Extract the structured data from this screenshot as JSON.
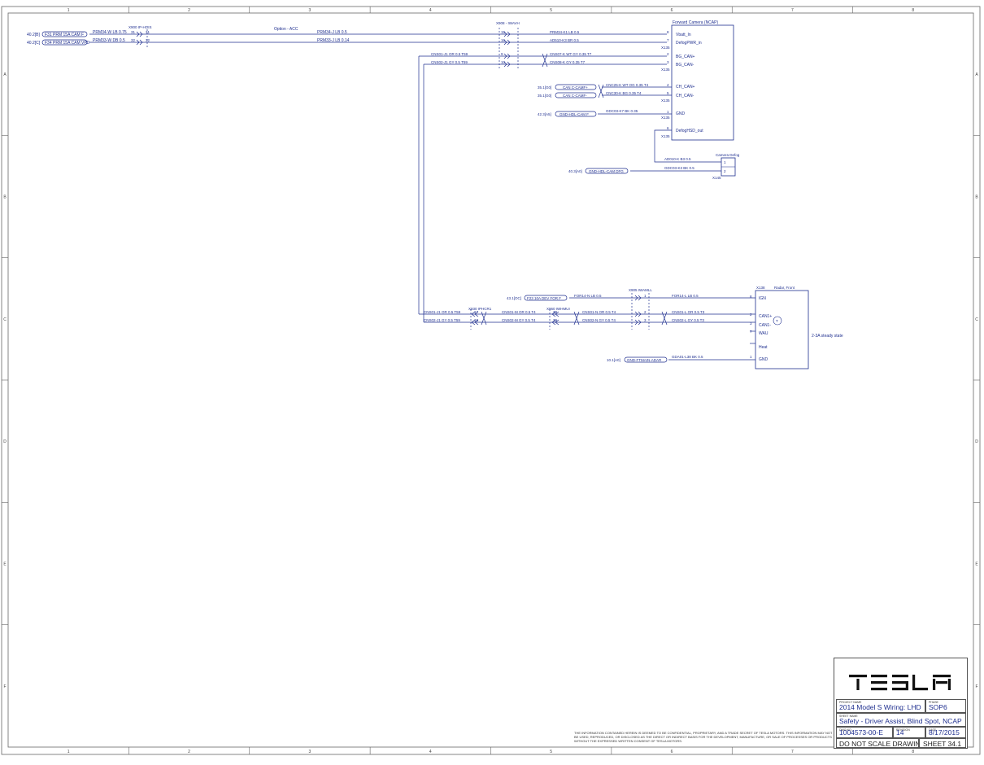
{
  "grid": {
    "columns": [
      "1",
      "2",
      "3",
      "4",
      "5",
      "6",
      "7",
      "8"
    ],
    "rows": [
      "A",
      "B",
      "C",
      "D",
      "E",
      "F"
    ]
  },
  "colors": {
    "wire": "#1f2f8f",
    "frame": "#666666",
    "text": "#1f2f8f"
  },
  "diagram": {
    "option_label": "Option - ACC",
    "top_left": {
      "connector": "X900 IP-HOIS",
      "wire1": {
        "ref": "40.2[B]",
        "fuse": "F31 PRM 15A CAM F",
        "w1": "PRM34-W LB 0.75",
        "pin_l": "31",
        "pin_r": "31",
        "w2": "PRM34-J LB 0.5"
      },
      "wire2": {
        "ref": "40.2[C]",
        "fuse": "F34 PRM 15A CAM VPD",
        "w1": "PRM33-W DB 0.5",
        "pin_l": "32",
        "pin_r": "32",
        "w2": "PRM33-J LB 0.14"
      }
    },
    "x908": {
      "label": "X908 - IWAVH",
      "pins": [
        "15",
        "16",
        "9",
        "10"
      ],
      "wires": [
        "PRM34-K1 LB 0.5",
        "AD510-K3 BR 0.5",
        "CNS07-K WT GY 0.35 T7",
        "CNS08-K GY 0.35 T7"
      ],
      "left_wires": [
        "CNS01-J1 OR 0.5 T59",
        "CNS02-J1 GY 0.5 T59"
      ]
    },
    "camera": {
      "title": "Forward Camera (NCAP)",
      "pins": [
        "8",
        "7",
        "2",
        "3",
        "4",
        "5",
        "1",
        "6"
      ],
      "labels": [
        "Vbatt_In",
        "DefogPWR_in",
        "BG_CAN+",
        "BG_CAN-",
        "CH_CAN+",
        "CH_CAN-",
        "GND",
        "DefogHSD_out"
      ],
      "conn": [
        "X135",
        "X135",
        "X135",
        "X135",
        "X135"
      ],
      "ch_wires": [
        "CNC25-K WT OG 0.35 T4",
        "CNC30-K BG 0.35 T4"
      ],
      "ch_refs": [
        "35.1[G0]",
        "35.1[G0]"
      ],
      "ch_splices": [
        "CAN C-CAMF+",
        "CAN C-CAMF-"
      ],
      "gnd_ref": "42.3[A5]",
      "gnd_splice": "GND-HDL-CAM F",
      "gnd_wire": "GDC03-K7 BK 0.35"
    },
    "defog": {
      "title": "Camera Defog",
      "conn": "X145",
      "pins": [
        "1",
        "2"
      ],
      "w1": "AD010-K B3 0.5",
      "w2": "GDC03-K3 BK 0.5",
      "ref": "40.3[A0]",
      "splice": "GND-HDL-CAM DFG"
    },
    "radar": {
      "title": "Radar, Front",
      "conn": "X138",
      "pins": [
        "8",
        "2",
        "3",
        "7",
        "1"
      ],
      "labels": [
        "IGN",
        "CAN1+",
        "CAN1-",
        "WAU",
        "Heat",
        "GND"
      ],
      "note": "2-3A steady state",
      "twist_label": "T",
      "ign_ref": "43.1[OC]",
      "ign_fuse": "F23 10A DEV FOR F",
      "ign_w1": "FOR14-N LB 0.5",
      "ign_w2": "FOR14-L LB 0.5",
      "x905": "X905 IWAMLL",
      "x930": "X930 IPHCR1",
      "x960": "X960 IWHMUI",
      "can_wires_left": [
        "CNS01-J1 OR 0.5 T59",
        "CNS02-J1 GY 0.5 T59"
      ],
      "can_wires_mid": [
        "CNS01-M OR 0.5 T4",
        "CNS02-M GY 0.5 T4"
      ],
      "can_wires_mid2": [
        "CNS01-N OR 0.5 T4",
        "CNS02-N GY 0.5 T4"
      ],
      "can_wires_right": [
        "CNS01-L OR 0.5 T3",
        "CNS02-L GY 0.5 T3"
      ],
      "pins_930": [
        "17",
        "18"
      ],
      "pins_960": [
        "38",
        "39"
      ],
      "pins_905": [
        "2",
        "3",
        "1"
      ],
      "gnd_ref": "10.1[A0]",
      "gnd_splice": "GND-FTMAIN-ADAR",
      "gnd_wire": "GDA01-L38 BK 0.5"
    }
  },
  "title_block": {
    "logo": "TESLA",
    "project_caption": "PROJECT NAME",
    "project": "2014 Model S Wiring: LHD",
    "phase_caption": "PHASE",
    "phase": "SOP6",
    "sheet_name_caption": "SHEET NAME",
    "sheet_name": "Safety - Driver Assist, Blind Spot, NCAP",
    "number_caption": "DWG NO.",
    "number": "1004573-00-E",
    "revision_caption": "REVISION",
    "revision": "14",
    "date_caption": "DATE",
    "date": "8/17/2015",
    "scale_note": "DO NOT SCALE DRAWING",
    "sheet": "SHEET 34.1",
    "disclaimer": "THE INFORMATION CONTAINED HEREIN IS DEEMED TO BE CONFIDENTIAL, PROPRIETARY, AND A TRADE SECRET OF TESLA MOTORS. THIS INFORMATION MAY NOT BE USED, REPRODUCED, OR DISCLOSED AS THE DIRECT OR INDIRECT BASIS FOR THE DEVELOPMENT, MANUFACTURE, OR SALE OF PROCESSES OR PRODUCTS WITHOUT THE EXPRESSED WRITTEN CONSENT OF TESLA MOTORS."
  }
}
